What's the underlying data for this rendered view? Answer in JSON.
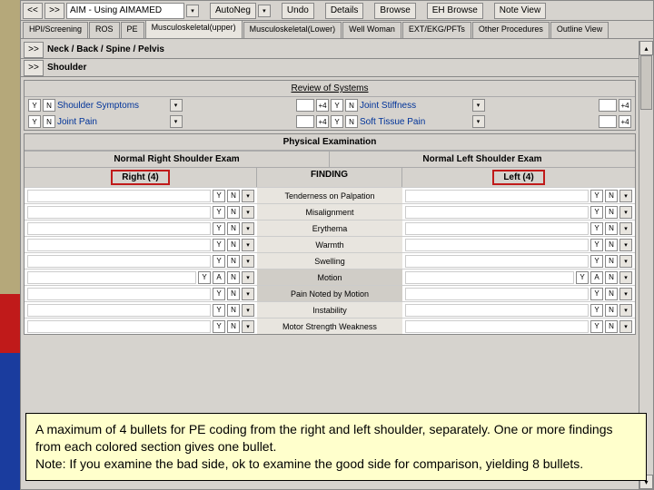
{
  "toolbar": {
    "back": "<<",
    "fwd": ">>",
    "title": "AIM - Using AIMAMED",
    "autoneg": "AutoNeg",
    "undo": "Undo",
    "details": "Details",
    "browse": "Browse",
    "ehbrowse": "EH Browse",
    "noteview": "Note View"
  },
  "tabs": {
    "hpi": "HPI/Screening",
    "ros": "ROS",
    "pe": "PE",
    "musc_u": "Musculoskeletal(upper)",
    "musc_l": "Musculoskeletal(Lower)",
    "well": "Well Woman",
    "ext": "EXT/EKG/PFTs",
    "other": "Other Procedures",
    "outline": "Outline View"
  },
  "crumb1": "Neck / Back / Spine / Pelvis",
  "crumb2": "Shoulder",
  "nav": ">>",
  "ros": {
    "title": "Review of Systems",
    "y": "Y",
    "n": "N",
    "l1": "Shoulder Symptoms",
    "l2": "Joint Pain",
    "r1": "Joint Stiffness",
    "r2": "Soft Tissue Pain",
    "btn": "+4"
  },
  "pe": {
    "title": "Physical Examination",
    "nr": "Normal Right Shoulder Exam",
    "nl": "Normal Left Shoulder Exam",
    "right": "Right (4)",
    "finding": "FINDING",
    "left": "Left (4)",
    "y": "Y",
    "n": "N",
    "a": "A",
    "rows": [
      "Tenderness on Palpation",
      "Misalignment",
      "Erythema",
      "Warmth",
      "Swelling",
      "Motion",
      "Pain Noted by Motion",
      "Instability",
      "Motor Strength Weakness"
    ]
  },
  "note": "A maximum of 4 bullets for PE coding from the right and left shoulder, separately.  One or more findings from each colored section gives one bullet.\nNote: If you examine the bad side, ok to examine the good side for comparison, yielding 8 bullets."
}
